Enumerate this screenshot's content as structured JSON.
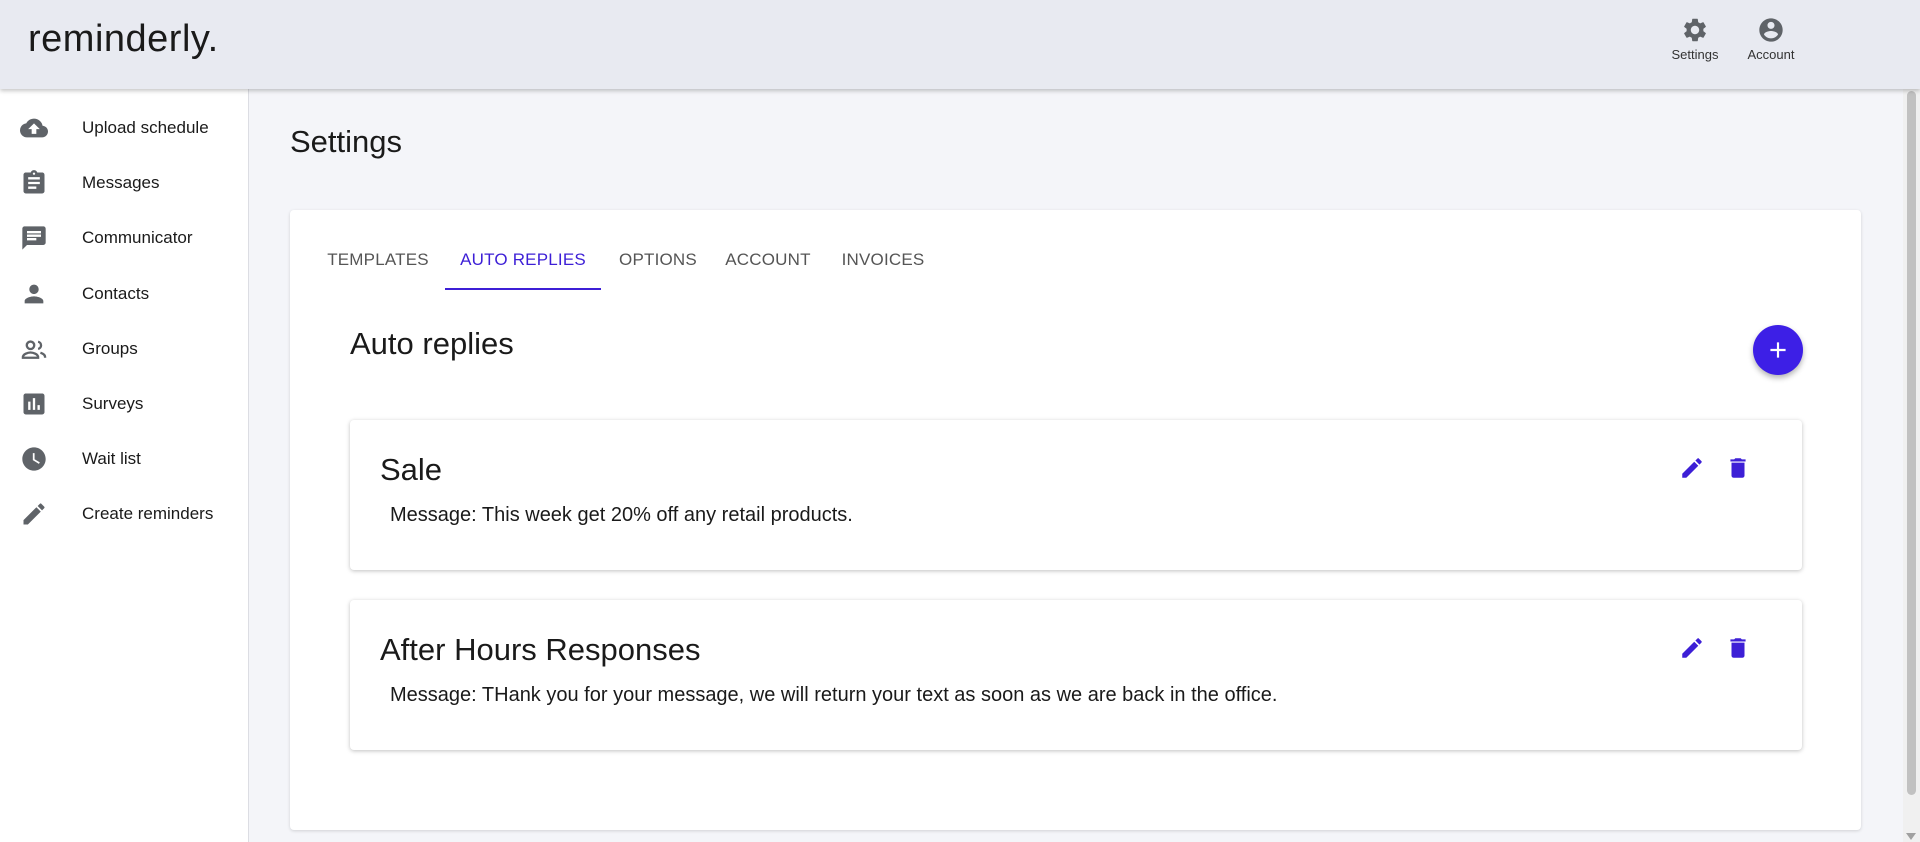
{
  "app": {
    "logo": "reminderly."
  },
  "header": {
    "settings_label": "Settings",
    "account_label": "Account"
  },
  "sidebar": {
    "items": [
      {
        "label": "Upload schedule",
        "icon": "cloud-upload-icon"
      },
      {
        "label": "Messages",
        "icon": "clipboard-icon"
      },
      {
        "label": "Communicator",
        "icon": "chat-icon"
      },
      {
        "label": "Contacts",
        "icon": "person-icon"
      },
      {
        "label": "Groups",
        "icon": "people-icon"
      },
      {
        "label": "Surveys",
        "icon": "bar-chart-icon"
      },
      {
        "label": "Wait list",
        "icon": "clock-icon"
      },
      {
        "label": "Create reminders",
        "icon": "pencil-icon"
      }
    ]
  },
  "main": {
    "page_title": "Settings",
    "tabs": [
      {
        "label": "TEMPLATES",
        "active": false
      },
      {
        "label": "AUTO REPLIES",
        "active": true
      },
      {
        "label": "OPTIONS",
        "active": false
      },
      {
        "label": "ACCOUNT",
        "active": false
      },
      {
        "label": "INVOICES",
        "active": false
      }
    ],
    "section_title": "Auto replies",
    "auto_replies": [
      {
        "title": "Sale",
        "message": "Message: This week get 20% off any retail products."
      },
      {
        "title": "After Hours Responses",
        "message": "Message: THank you for your message, we will return your text as soon as we are back in the office."
      }
    ]
  },
  "colors": {
    "accent": "#3d1fd6",
    "fab": "#3d1fe6",
    "header_bg": "#e8eaf1",
    "page_bg": "#f4f5f9",
    "icon_gray": "#5f6368"
  }
}
